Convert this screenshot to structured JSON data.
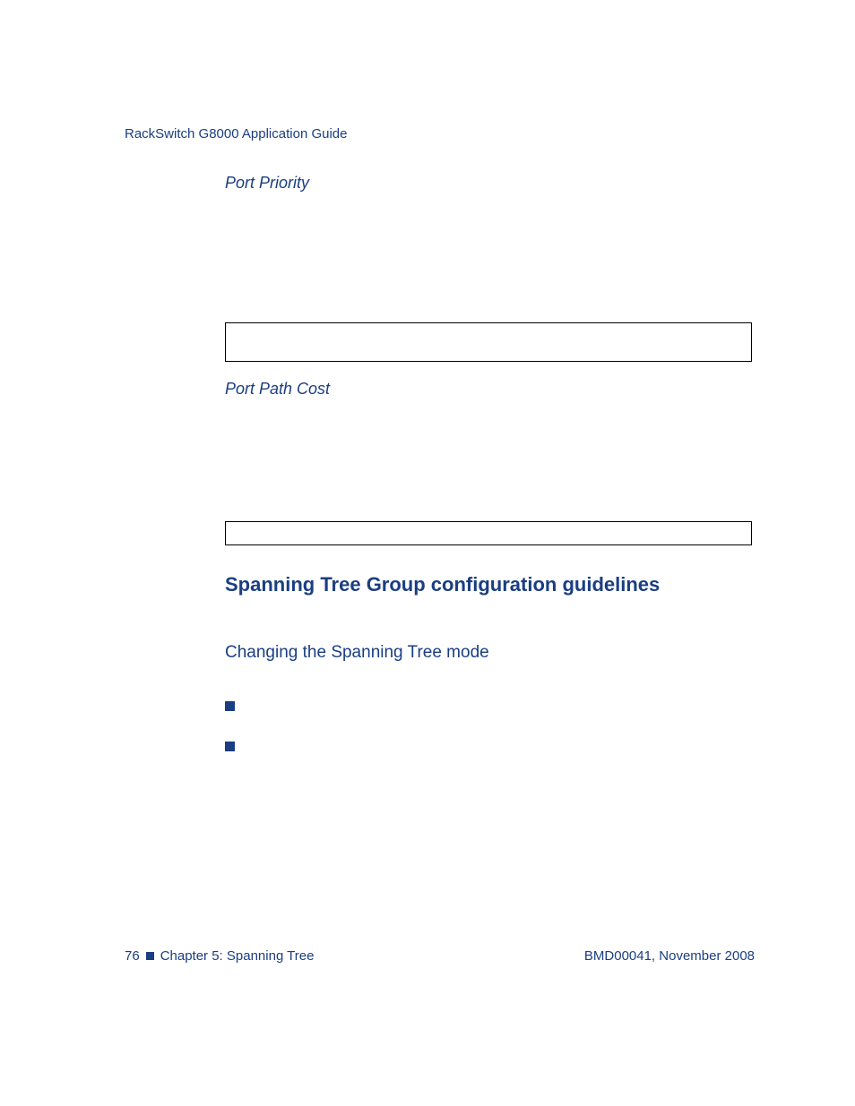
{
  "header": {
    "title": "RackSwitch G8000  Application Guide"
  },
  "sections": {
    "port_priority": "Port Priority",
    "port_path_cost": "Port Path Cost"
  },
  "heading": "Spanning Tree Group configuration guidelines",
  "subheading": "Changing the Spanning Tree mode",
  "footer": {
    "page_number": "76",
    "chapter": "Chapter 5:  Spanning Tree",
    "doc_id": "BMD00041, November 2008"
  }
}
